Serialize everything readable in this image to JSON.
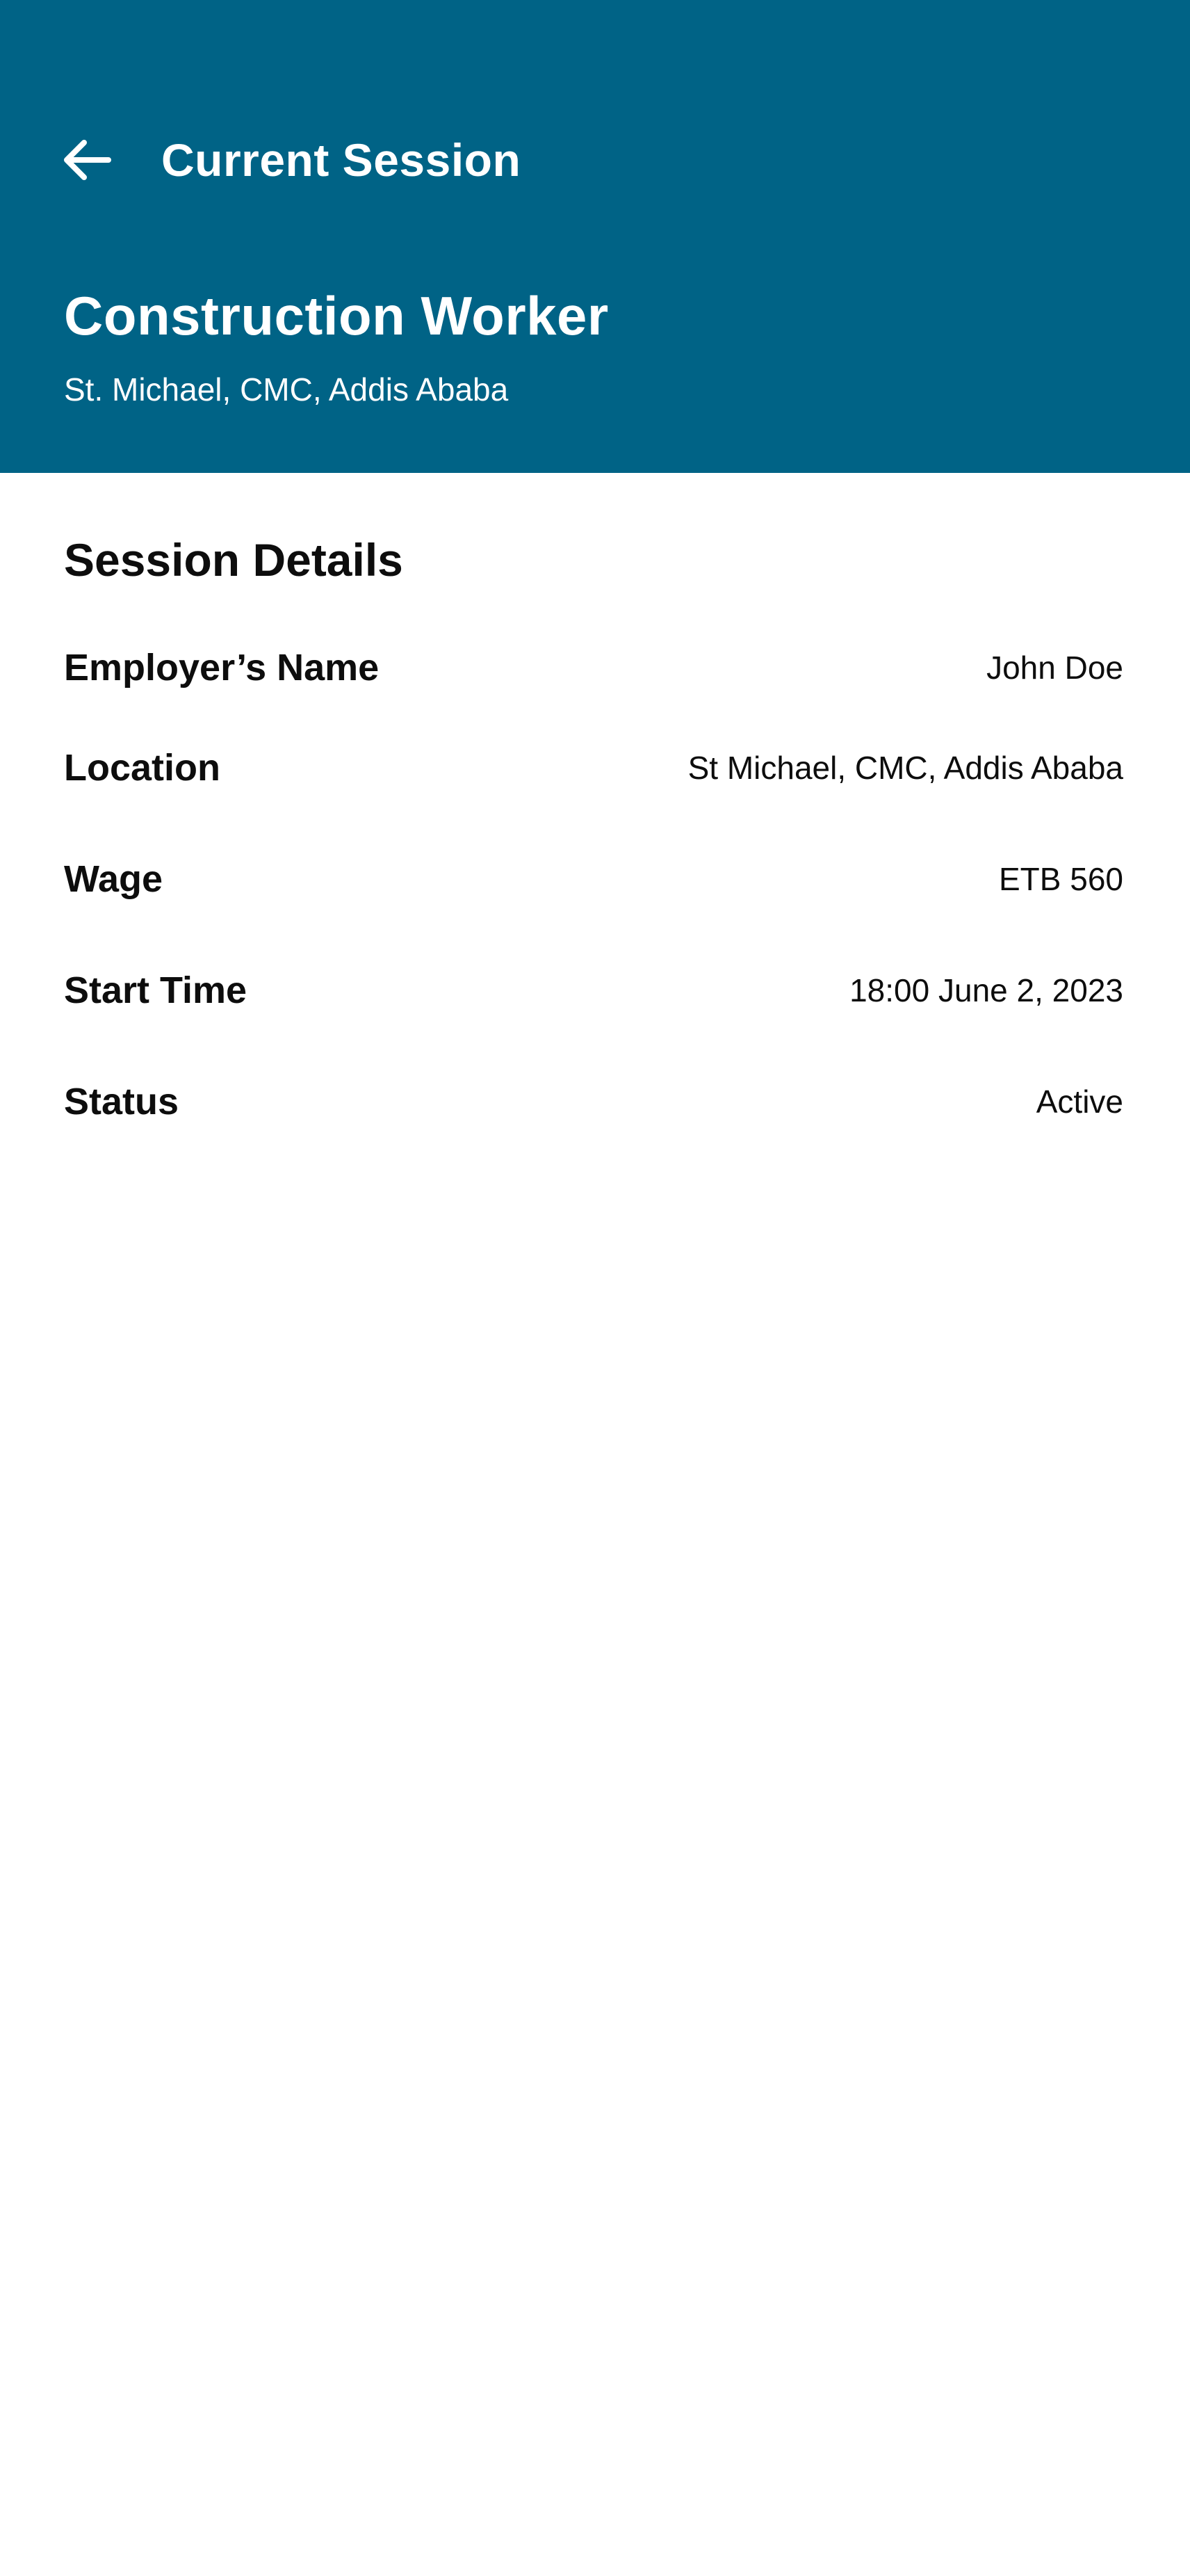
{
  "header": {
    "title": "Current Session",
    "back_icon": "arrow-left-icon",
    "background_color": "#006386",
    "text_color": "#ffffff"
  },
  "job": {
    "title": "Construction Worker",
    "location": "St. Michael, CMC, Addis Ababa"
  },
  "session_details": {
    "title": "Session Details",
    "rows": [
      {
        "label": "Employer’s Name",
        "value": "John Doe"
      },
      {
        "label": "Location",
        "value": "St Michael, CMC, Addis Ababa"
      },
      {
        "label": "Wage",
        "value": "ETB 560"
      },
      {
        "label": "Start Time",
        "value": "18:00 June 2, 2023"
      },
      {
        "label": "Status",
        "value": "Active"
      }
    ]
  }
}
